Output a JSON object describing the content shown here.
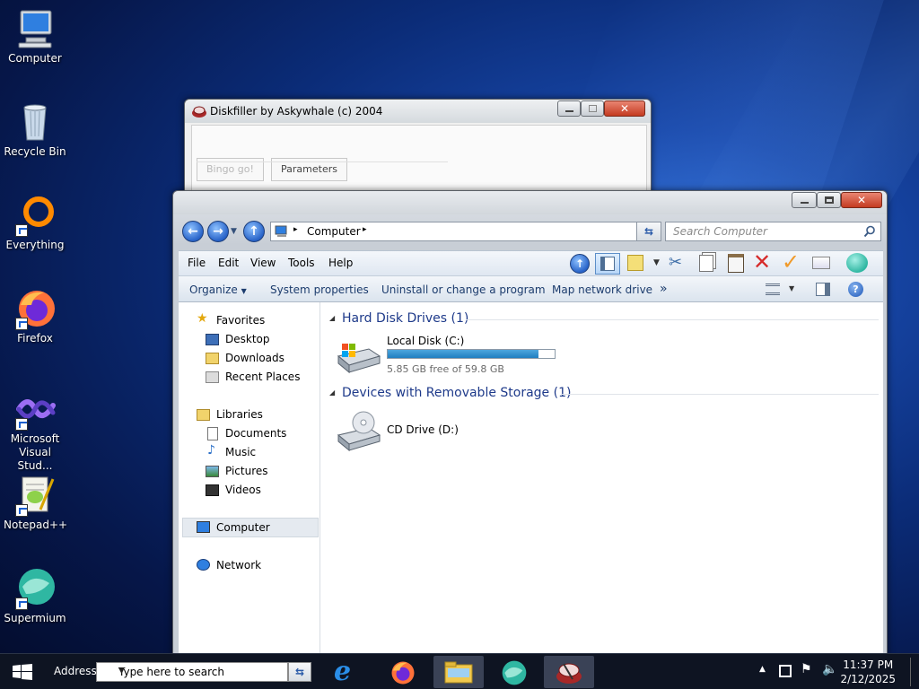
{
  "desktop": {
    "icons": [
      {
        "label": "Computer",
        "icon": "computer-icon"
      },
      {
        "label": "Recycle Bin",
        "icon": "recycle-bin-icon"
      },
      {
        "label": "Everything",
        "icon": "everything-icon"
      },
      {
        "label": "Firefox",
        "icon": "firefox-icon"
      },
      {
        "label": "Microsoft Visual Stud...",
        "icon": "visual-studio-icon"
      },
      {
        "label": "Notepad++",
        "icon": "notepadpp-icon"
      },
      {
        "label": "Supermium",
        "icon": "supermium-icon"
      }
    ]
  },
  "diskfiller": {
    "title": "Diskfiller by Askywhale (c) 2004",
    "buttons": [
      "Bingo go!",
      "Parameters"
    ]
  },
  "explorer": {
    "address": "Computer",
    "search_placeholder": "Search Computer",
    "menu": [
      "File",
      "Edit",
      "View",
      "Tools",
      "Help"
    ],
    "commands": [
      "Organize",
      "System properties",
      "Uninstall or change a program",
      "Map network drive",
      "»"
    ],
    "nav": {
      "favorites": "Favorites",
      "favorites_items": [
        "Desktop",
        "Downloads",
        "Recent Places"
      ],
      "libraries": "Libraries",
      "libraries_items": [
        "Documents",
        "Music",
        "Pictures",
        "Videos"
      ],
      "computer": "Computer",
      "network": "Network"
    },
    "groups": {
      "hdd_title": "Hard Disk Drives (1)",
      "removable_title": "Devices with Removable Storage (1)"
    },
    "drives": {
      "c_name": "Local Disk (C:)",
      "c_free": "5.85 GB free of 59.8 GB",
      "c_used_fraction": 0.902,
      "d_name": "CD Drive (D:)"
    }
  },
  "taskbar": {
    "address_label": "Address",
    "search_text": "Type here to search",
    "time": "11:37 PM",
    "date": "2/12/2025"
  }
}
